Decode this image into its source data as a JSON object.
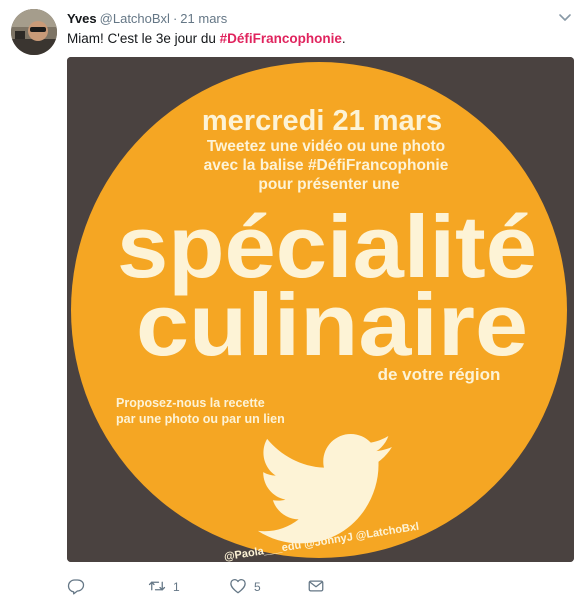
{
  "tweet": {
    "author_name": "Yves",
    "handle": "@LatchoBxl",
    "separator": "·",
    "time": "21 mars",
    "text_before": "Miam! C'est le 3e jour du ",
    "hashtag": "#DéfiFrancophonie",
    "text_after": "."
  },
  "image": {
    "date_line": "mercredi 21 mars",
    "line1": "Tweetez une vidéo ou une photo",
    "line2": "avec la balise #DéfiFrancophonie",
    "line3": "pour présenter une",
    "big1": "spécialité",
    "big2": "culinaire",
    "region": "de votre région",
    "propose1": "Proposez-nous la recette",
    "propose2": "par une photo ou par un lien",
    "credits": "@Paola___edu @JonnyJ @LatchoBxl"
  },
  "actions": {
    "reply_count": "",
    "retweet_count": "1",
    "like_count": "5"
  },
  "colors": {
    "hashtag": "#e0245e",
    "circle": "#f5a623",
    "image_background": "#4a4240",
    "image_text": "#fdf3d6",
    "meta_gray": "#657786"
  },
  "icons": {
    "menu": "chevron-down-icon",
    "reply": "reply-icon",
    "retweet": "retweet-icon",
    "like": "heart-icon",
    "bird": "twitter-bird-icon"
  }
}
